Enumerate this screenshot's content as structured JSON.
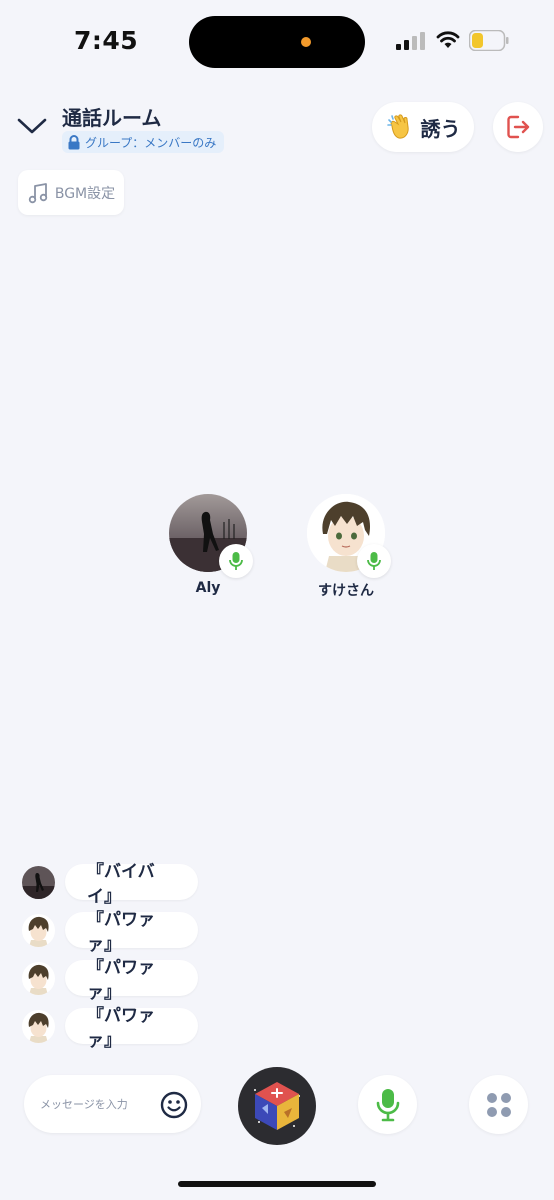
{
  "status_bar": {
    "time": "7:45"
  },
  "header": {
    "title": "通話ルーム",
    "badge": "グループ：メンバーのみ",
    "invite_label": "誘う",
    "bgm_label": "BGM設定"
  },
  "participants": [
    {
      "name": "Aly",
      "avatar": "photo-silhouette",
      "mic": "on"
    },
    {
      "name": "すけさん",
      "avatar": "anime-boy",
      "mic": "on"
    }
  ],
  "reactions": [
    {
      "text": "『バイバイ』",
      "avatar": "photo-silhouette"
    },
    {
      "text": "『パワァァ』",
      "avatar": "anime-boy"
    },
    {
      "text": "『パワァァ』",
      "avatar": "anime-boy"
    },
    {
      "text": "『パワァァ』",
      "avatar": "anime-boy"
    }
  ],
  "bottom_bar": {
    "message_placeholder": "メッセージを入力"
  },
  "colors": {
    "background": "#f4f5fa",
    "text": "#1f2a44",
    "mic_green": "#4cbb47",
    "leave_red": "#e0524f",
    "badge_blue": "#3a78c5"
  },
  "icons": [
    "chevron-down-icon",
    "lock-icon",
    "clap-icon",
    "leave-icon",
    "music-note-icon",
    "mic-icon",
    "emoji-icon",
    "game-cube-icon",
    "menu-grid-icon"
  ]
}
